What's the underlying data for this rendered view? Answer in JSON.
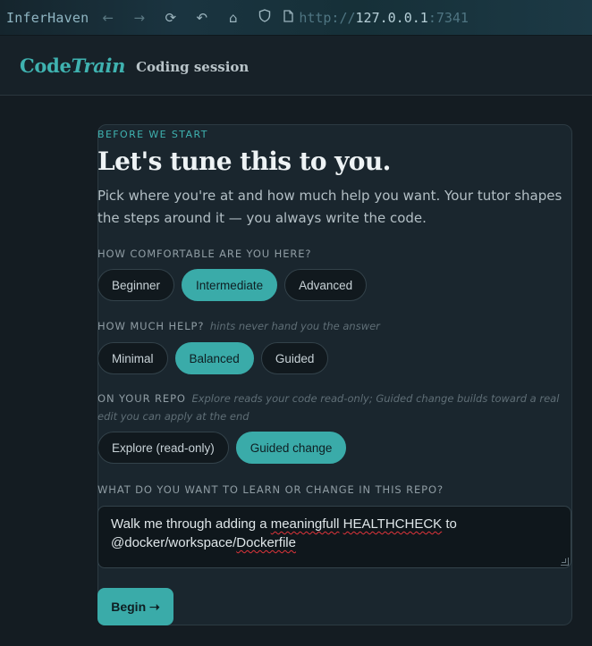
{
  "browser": {
    "brand": "InferHaven",
    "url_protocol": "http://",
    "url_host": "127.0.0.1",
    "url_port": ":7341",
    "icons": [
      "back-icon",
      "forward-icon",
      "reload-icon",
      "undo-icon",
      "home-icon",
      "shield-icon",
      "page-icon"
    ]
  },
  "app": {
    "logo_code": "Code",
    "logo_train": "Train",
    "session_title": "Coding session"
  },
  "card": {
    "eyebrow": "BEFORE WE START",
    "headline": "Let's tune this to you.",
    "intro": "Pick where you're at and how much help you want. Your tutor shapes the steps around it — you always write the code."
  },
  "comfort": {
    "label": "HOW COMFORTABLE ARE YOU HERE?",
    "options": [
      "Beginner",
      "Intermediate",
      "Advanced"
    ],
    "selected": "Intermediate"
  },
  "help": {
    "label": "HOW MUCH HELP?",
    "hint": "hints never hand you the answer",
    "options": [
      "Minimal",
      "Balanced",
      "Guided"
    ],
    "selected": "Balanced"
  },
  "repo": {
    "label": "ON YOUR REPO",
    "hint": "Explore reads your code read-only; Guided change builds toward a real edit you can apply at the end",
    "options": [
      "Explore (read-only)",
      "Guided change"
    ],
    "selected": "Guided change"
  },
  "goal": {
    "label": "WHAT DO YOU WANT TO LEARN OR CHANGE IN THIS REPO?",
    "value": "Walk me through adding a meaningfull HEALTHCHECK to @docker/workspace/Dockerfile"
  },
  "begin_label": "Begin ➝",
  "colors": {
    "accent": "#3aaba9",
    "background": "#141c22",
    "card": "#1a262e"
  }
}
